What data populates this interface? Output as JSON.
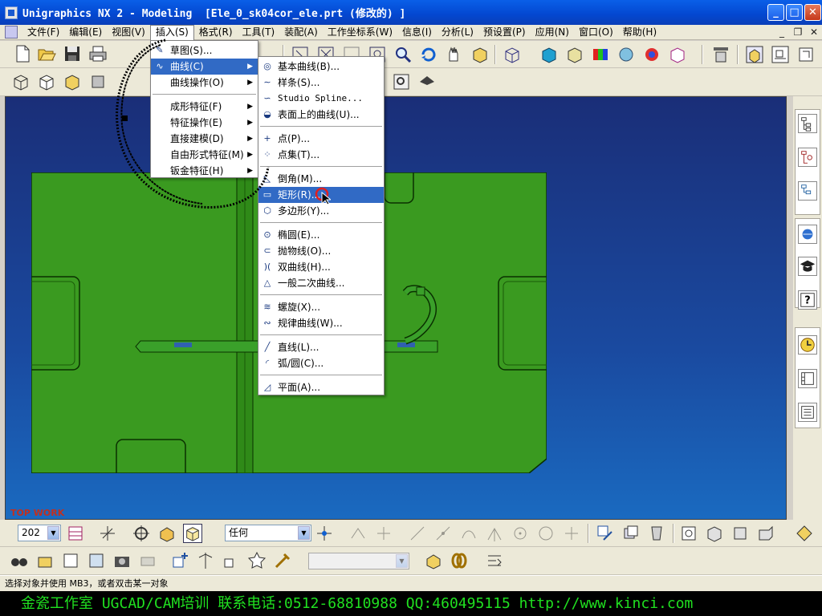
{
  "window": {
    "title": "Unigraphics NX 2 - Modeling  [Ele_0_sk04cor_ele.prt (修改的) ]",
    "minimize_label": "_",
    "maximize_label": "□",
    "close_label": "✕"
  },
  "menubar": {
    "items": [
      {
        "label": "文件(F)"
      },
      {
        "label": "编辑(E)"
      },
      {
        "label": "视图(V)"
      },
      {
        "label": "插入(S)"
      },
      {
        "label": "格式(R)"
      },
      {
        "label": "工具(T)"
      },
      {
        "label": "装配(A)"
      },
      {
        "label": "工作坐标系(W)"
      },
      {
        "label": "信息(I)"
      },
      {
        "label": "分析(L)"
      },
      {
        "label": "预设置(P)"
      },
      {
        "label": "应用(N)"
      },
      {
        "label": "窗口(O)"
      },
      {
        "label": "帮助(H)"
      }
    ],
    "mdi_min": "_",
    "mdi_restore": "❐",
    "mdi_close": "✕"
  },
  "insert_menu": {
    "items": [
      {
        "label": "草图(S)...",
        "icon": "sketch-icon"
      },
      {
        "label": "曲线(C)",
        "icon": "curve-icon",
        "submenu": true,
        "highlighted": true
      },
      {
        "label": "曲线操作(O)",
        "submenu": true
      },
      {
        "label": "成形特征(F)",
        "submenu": true
      },
      {
        "label": "特征操作(E)",
        "submenu": true
      },
      {
        "label": "直接建模(D)",
        "submenu": true
      },
      {
        "label": "自由形式特征(M)",
        "submenu": true
      },
      {
        "label": "钣金特征(H)",
        "submenu": true
      }
    ]
  },
  "curve_menu": {
    "items": [
      {
        "label": "基本曲线(B)...",
        "icon": "basic-curve-icon"
      },
      {
        "label": "样条(S)...",
        "icon": "spline-icon"
      },
      {
        "label": "Studio Spline...",
        "icon": "studio-spline-icon"
      },
      {
        "label": "表面上的曲线(U)...",
        "icon": "curve-on-surface-icon"
      },
      {
        "label": "点(P)...",
        "icon": "point-icon"
      },
      {
        "label": "点集(T)...",
        "icon": "point-set-icon"
      },
      {
        "label": "倒角(M)...",
        "icon": "chamfer-icon"
      },
      {
        "label": "矩形(R)...",
        "icon": "rectangle-icon",
        "highlighted": true
      },
      {
        "label": "多边形(Y)...",
        "icon": "polygon-icon"
      },
      {
        "label": "椭圆(E)...",
        "icon": "ellipse-icon"
      },
      {
        "label": "抛物线(O)...",
        "icon": "parabola-icon"
      },
      {
        "label": "双曲线(H)...",
        "icon": "hyperbola-icon"
      },
      {
        "label": "一般二次曲线...",
        "icon": "conic-icon"
      },
      {
        "label": "螺旋(X)...",
        "icon": "helix-icon"
      },
      {
        "label": "规律曲线(W)...",
        "icon": "law-curve-icon"
      },
      {
        "label": "直线(L)...",
        "icon": "line-icon"
      },
      {
        "label": "弧/圆(C)...",
        "icon": "arc-circle-icon"
      },
      {
        "label": "平面(A)...",
        "icon": "plane-icon"
      }
    ]
  },
  "viewport": {
    "watermark": "TOP WORK",
    "model_color": "#3a9a20"
  },
  "bottom_toolbar": {
    "layer_value": "202",
    "filter_value": "任何",
    "dropdown_arrow": "▼"
  },
  "status": {
    "text": "选择对象并使用 MB3，或者双击某一对象"
  },
  "banner": {
    "text": "金瓷工作室 UGCAD/CAM培训 联系电话:0512-68810988 QQ:460495115 http://www.kinci.com"
  }
}
